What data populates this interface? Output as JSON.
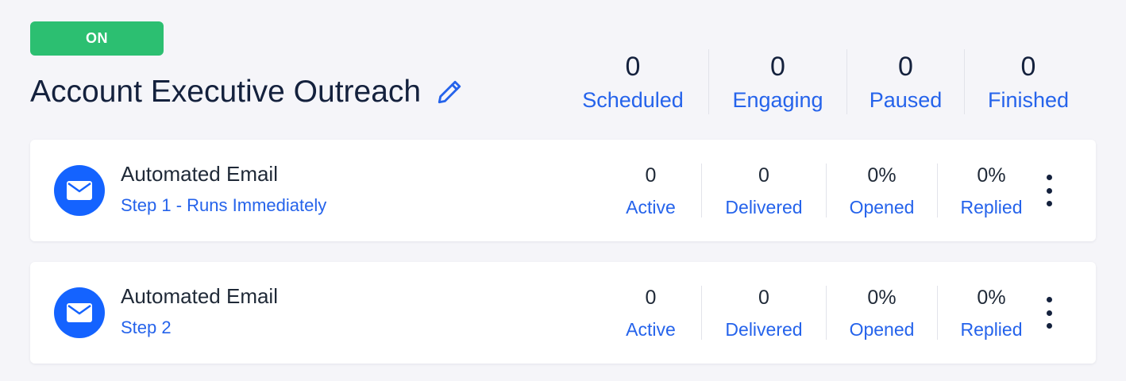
{
  "status": {
    "label": "ON",
    "color": "#2cbf71"
  },
  "sequence": {
    "title": "Account Executive Outreach",
    "edit_icon": "pencil-icon"
  },
  "summary": [
    {
      "value": "0",
      "label": "Scheduled"
    },
    {
      "value": "0",
      "label": "Engaging"
    },
    {
      "value": "0",
      "label": "Paused"
    },
    {
      "value": "0",
      "label": "Finished"
    }
  ],
  "steps": [
    {
      "type": "Automated Email",
      "subtitle": "Step 1 - Runs Immediately",
      "icon": "mail-icon",
      "metrics": [
        {
          "value": "0",
          "label": "Active"
        },
        {
          "value": "0",
          "label": "Delivered"
        },
        {
          "value": "0%",
          "label": "Opened"
        },
        {
          "value": "0%",
          "label": "Replied"
        }
      ],
      "menu_icon": "kebab-menu-icon"
    },
    {
      "type": "Automated Email",
      "subtitle": "Step 2",
      "icon": "mail-icon",
      "metrics": [
        {
          "value": "0",
          "label": "Active"
        },
        {
          "value": "0",
          "label": "Delivered"
        },
        {
          "value": "0%",
          "label": "Opened"
        },
        {
          "value": "0%",
          "label": "Replied"
        }
      ],
      "menu_icon": "kebab-menu-icon"
    }
  ],
  "colors": {
    "accent": "#2563eb",
    "icon_bg": "#1463ff",
    "title": "#14213d"
  }
}
